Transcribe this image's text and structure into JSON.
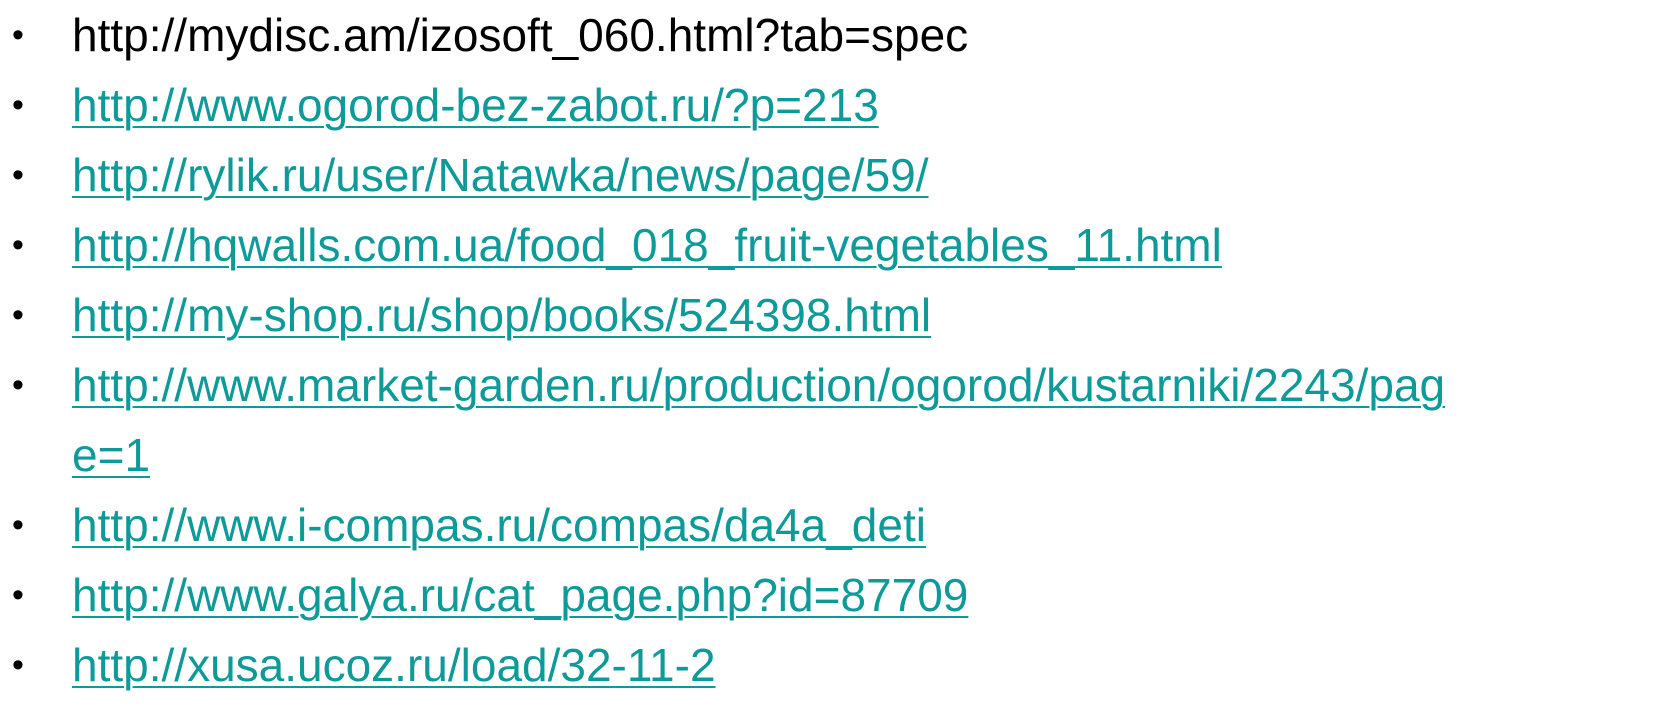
{
  "colors": {
    "link": "#0f9a9a",
    "text": "#000000",
    "background": "#ffffff"
  },
  "bullet_char": "•",
  "items": [
    {
      "text": "http://mydisc.am/izosoft_060.html?tab=spec",
      "is_link": false
    },
    {
      "text": "http://www.ogorod-bez-zabot.ru/?p=213",
      "is_link": true
    },
    {
      "text": "http://rylik.ru/user/Natawka/news/page/59/",
      "is_link": true
    },
    {
      "text": "http://hqwalls.com.ua/food_018_fruit-vegetables_11.html",
      "is_link": true
    },
    {
      "text": "http://my-shop.ru/shop/books/524398.html",
      "is_link": true
    },
    {
      "text": "http://www.market-garden.ru/production/ogorod/kustarniki/2243/pag",
      "text_cont": "e=1",
      "is_link": true
    },
    {
      "text": "http://www.i-compas.ru/compas/da4a_deti",
      "is_link": true
    },
    {
      "text": "http://www.galya.ru/cat_page.php?id=87709",
      "is_link": true
    },
    {
      "text": "http://xusa.ucoz.ru/load/32-11-2",
      "is_link": true
    }
  ]
}
